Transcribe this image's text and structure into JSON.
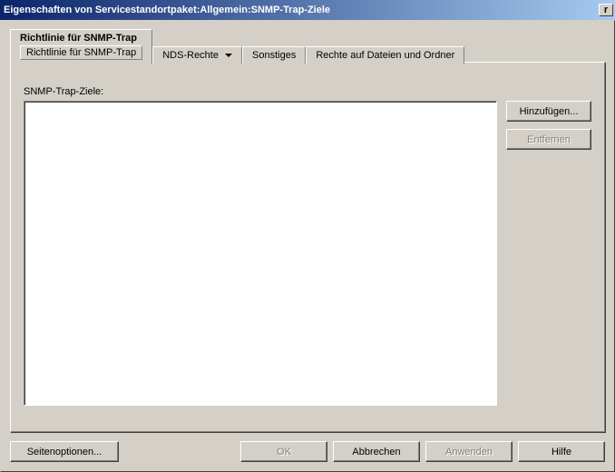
{
  "title": "Eigenschaften von Servicestandortpaket:Allgemein:SNMP-Trap-Ziele",
  "tabs": {
    "t0": {
      "label": "Richtlinie für SNMP-Trap",
      "sublabel": "Richtlinie für SNMP-Trap"
    },
    "t1": {
      "label": "NDS-Rechte"
    },
    "t2": {
      "label": "Sonstiges"
    },
    "t3": {
      "label": "Rechte auf Dateien und Ordner"
    }
  },
  "content": {
    "list_label": "SNMP-Trap-Ziele:",
    "items": []
  },
  "side_buttons": {
    "add": "Hinzufügen...",
    "remove": "Entfernen"
  },
  "bottom": {
    "page_options": "Seitenoptionen...",
    "ok": "OK",
    "cancel": "Abbrechen",
    "apply": "Anwenden",
    "help": "Hilfe"
  }
}
